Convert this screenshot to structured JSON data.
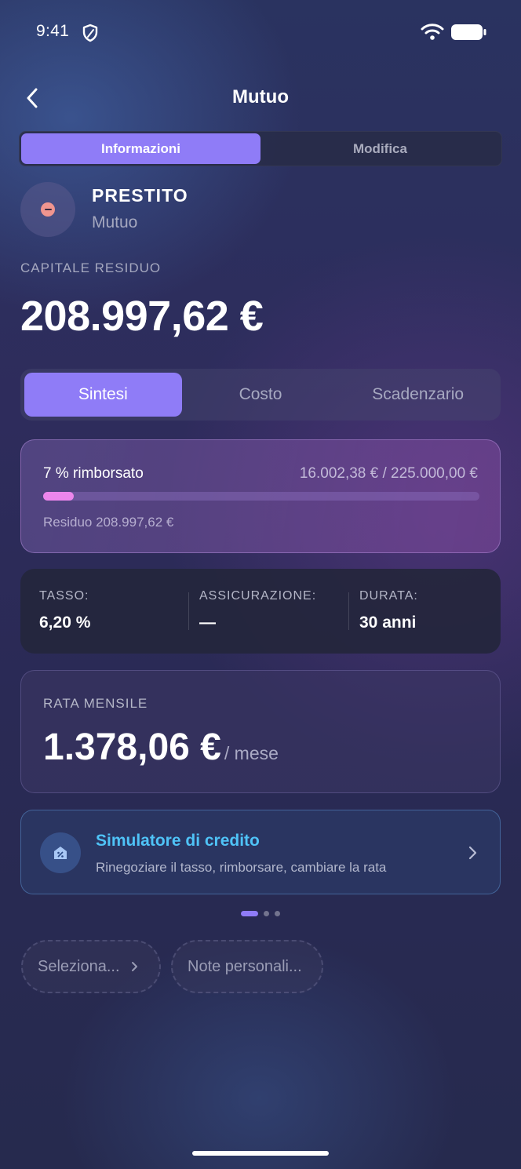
{
  "status_bar": {
    "time": "9:41"
  },
  "header": {
    "title": "Mutuo"
  },
  "top_tabs": [
    {
      "label": "Informazioni",
      "active": true
    },
    {
      "label": "Modifica",
      "active": false
    }
  ],
  "account": {
    "name": "PRESTITO",
    "type": "Mutuo",
    "icon": "minus-circle-icon"
  },
  "capital": {
    "label": "CAPITALE RESIDUO",
    "value": "208.997,62 €"
  },
  "sub_tabs": [
    {
      "label": "Sintesi",
      "active": true
    },
    {
      "label": "Costo",
      "active": false
    },
    {
      "label": "Scadenzario",
      "active": false
    }
  ],
  "progress": {
    "label": "7 % rimborsato",
    "amount": "16.002,38 € / 225.000,00 €",
    "fraction": 0.07,
    "residual": "Residuo 208.997,62 €"
  },
  "info": [
    {
      "label": "TASSO:",
      "value": "6,20 %"
    },
    {
      "label": "ASSICURAZIONE:",
      "value": "—"
    },
    {
      "label": "DURATA:",
      "value": "30 anni"
    }
  ],
  "rata": {
    "label": "RATA MENSILE",
    "value": "1.378,06 €",
    "unit": "/ mese"
  },
  "simulator": {
    "title": "Simulatore di credito",
    "subtitle": "Rinegoziare il tasso, rimborsare, cambiare la rata",
    "icon": "calculator-house-icon"
  },
  "pager": {
    "count": 3,
    "active": 0
  },
  "chips": {
    "select": "Seleziona...",
    "notes": "Note personali..."
  },
  "colors": {
    "accent": "#8f7cf7",
    "progress_fill": "#ec86ec",
    "link": "#4fc3f7"
  }
}
